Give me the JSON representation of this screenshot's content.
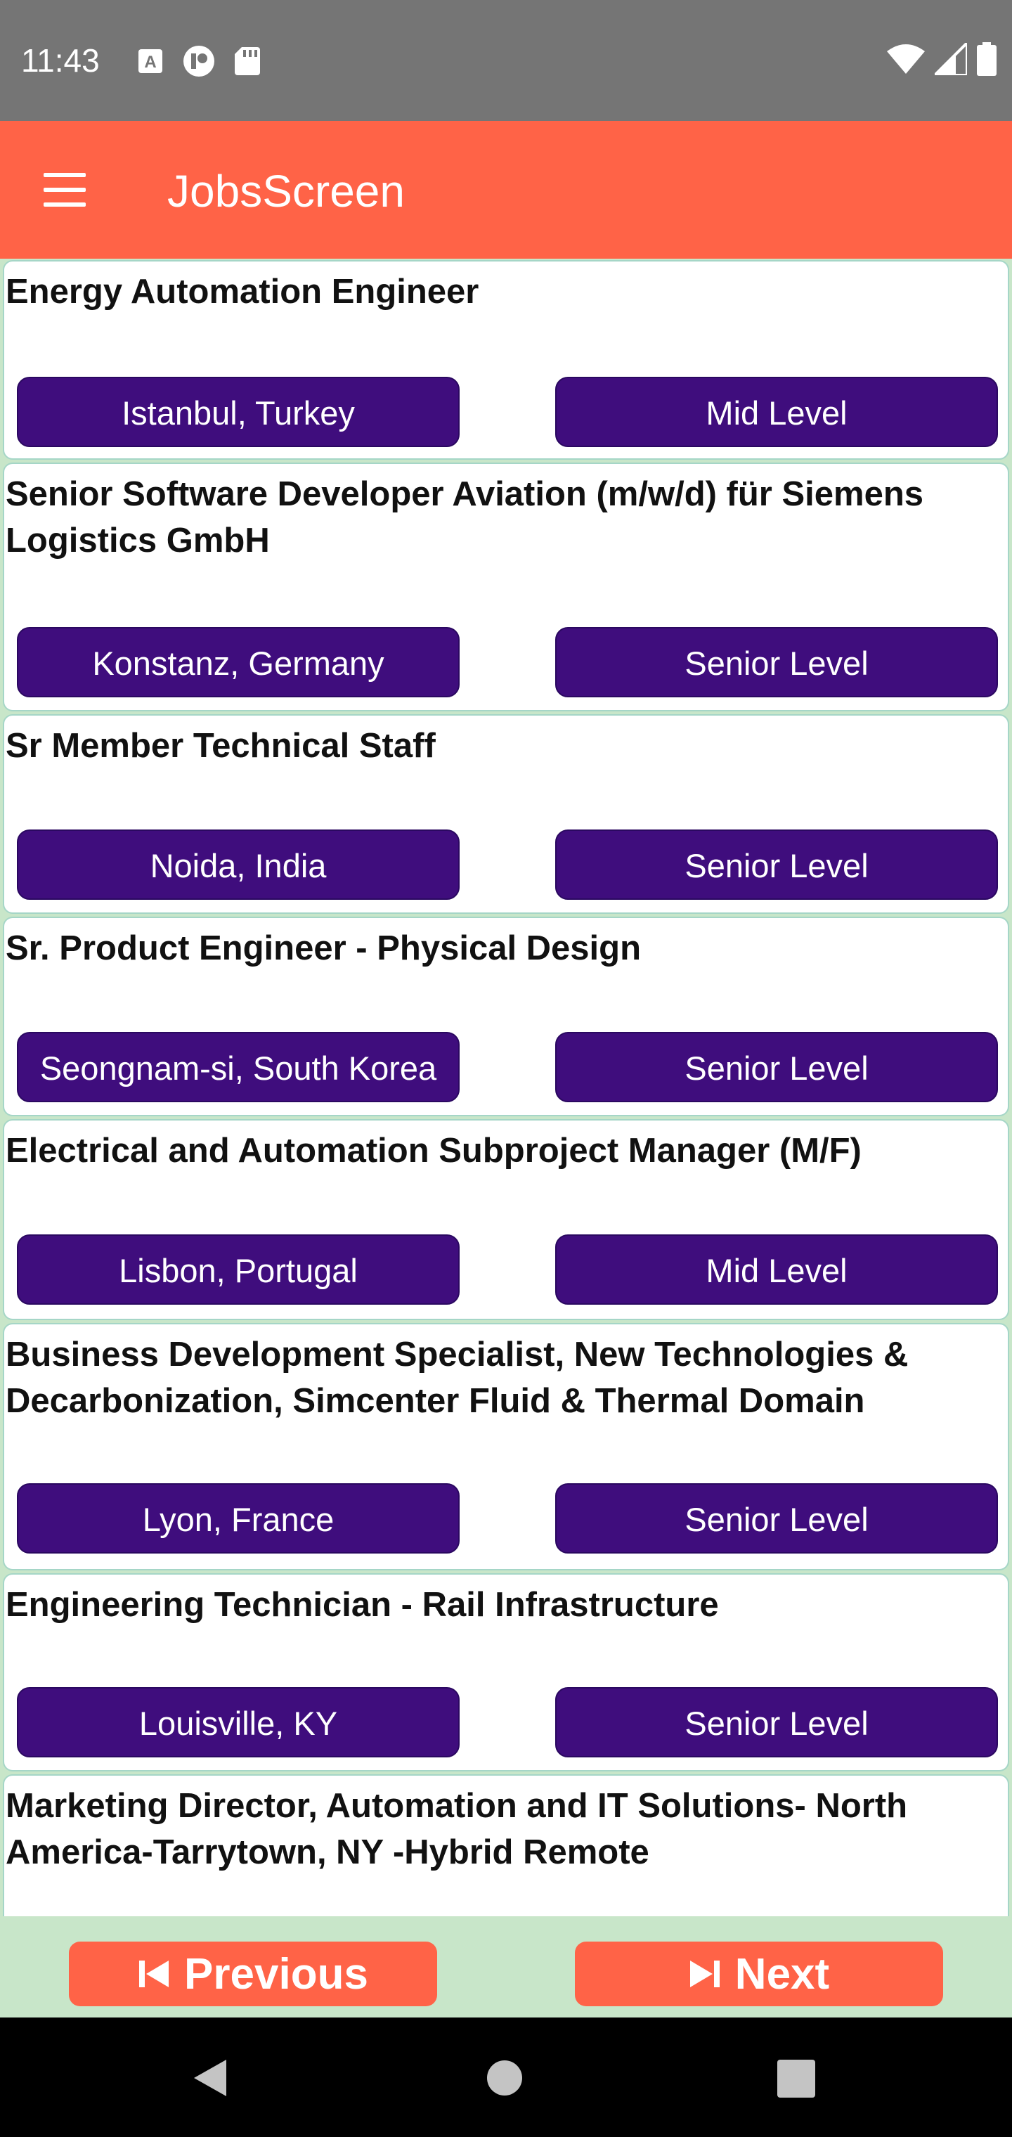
{
  "status_bar": {
    "time": "11:43",
    "icons_left": [
      "font-notification-icon",
      "media-notification-icon",
      "sd-card-icon"
    ],
    "icons_right": [
      "wifi-icon",
      "signal-icon",
      "battery-icon"
    ]
  },
  "app_bar": {
    "menu_icon": "hamburger-menu-icon",
    "title": "JobsScreen"
  },
  "jobs": [
    {
      "title": "Energy Automation Engineer",
      "location": "Istanbul, Turkey",
      "level": "Mid Level"
    },
    {
      "title": "Senior Software Developer Aviation (m/w/d) für Siemens Logistics GmbH",
      "location": "Konstanz, Germany",
      "level": "Senior Level"
    },
    {
      "title": "Sr Member Technical Staff",
      "location": "Noida, India",
      "level": "Senior Level"
    },
    {
      "title": "Sr. Product Engineer - Physical Design",
      "location": "Seongnam-si, South Korea",
      "level": "Senior Level"
    },
    {
      "title": "Electrical and Automation Subproject Manager (M/F)",
      "location": "Lisbon, Portugal",
      "level": "Mid Level"
    },
    {
      "title": "Business Development Specialist, New Technologies & Decarbonization, Simcenter Fluid & Thermal Domain",
      "location": "Lyon, France",
      "level": "Senior Level"
    },
    {
      "title": "Engineering Technician - Rail Infrastructure",
      "location": "Louisville, KY",
      "level": "Senior Level"
    },
    {
      "title": "Marketing Director, Automation and IT Solutions- North America-Tarrytown, NY -Hybrid Remote"
    }
  ],
  "pagination": {
    "previous_label": "Previous",
    "next_label": "Next",
    "previous_icon": "skip-previous-icon",
    "next_icon": "skip-next-icon"
  },
  "nav_bar": {
    "icons": [
      "back-icon",
      "home-icon",
      "recents-icon"
    ]
  },
  "colors": {
    "app_bar": "#ff6347",
    "chip": "#3f0d7d",
    "background": "#c8e6c9",
    "status_bar": "#757575"
  }
}
